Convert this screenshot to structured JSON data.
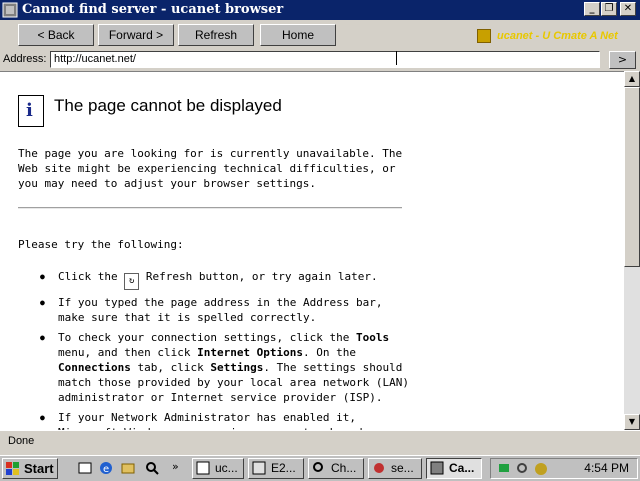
{
  "window": {
    "title": "Cannot find server - ucanet browser",
    "min_btn": "_",
    "max_btn": "❐",
    "close_btn": "✕"
  },
  "toolbar": {
    "back": "< Back",
    "forward": "Forward >",
    "refresh": "Refresh",
    "home": "Home",
    "brand_text": "ucanet - U Cmate A Net"
  },
  "address": {
    "label": "Address:",
    "value": "http://ucanet.net/",
    "go": ">"
  },
  "page": {
    "heading": "The page cannot be displayed",
    "intro": "The page you are looking for is currently unavailable. The Web site might be experiencing technical difficulties, or you may need to adjust your browser settings.",
    "try_following": "Please try the following:",
    "items": {
      "item1_pre": "Click the",
      "item1_post": "Refresh button, or try again later.",
      "item2": "If you typed the page address in the Address bar, make sure that it is spelled correctly.",
      "item3_a": "To check your connection settings, click the",
      "item3_tools": "Tools",
      "item3_b": "menu, and then click",
      "item3_internet": "Internet Options",
      "item3_c": ". On the",
      "item3_connections": "Connections",
      "item3_d": "tab, click",
      "item3_settings": "Settings",
      "item3_e": ". The settings should match those provided by your local area network (LAN) administrator or Internet service provider (ISP).",
      "item4": "If your Network Administrator has enabled it, Microsoft Windows can examine your network and automatically discover network connection settings."
    }
  },
  "status": {
    "text": "Done"
  },
  "taskbar": {
    "start": "Start",
    "tasks": [
      "uc...",
      "E2...",
      "Ch...",
      "se...",
      "Ca..."
    ],
    "clock": "4:54 PM"
  },
  "colors": {
    "titlebar": "#0a246a",
    "brand": "#e8c800"
  }
}
